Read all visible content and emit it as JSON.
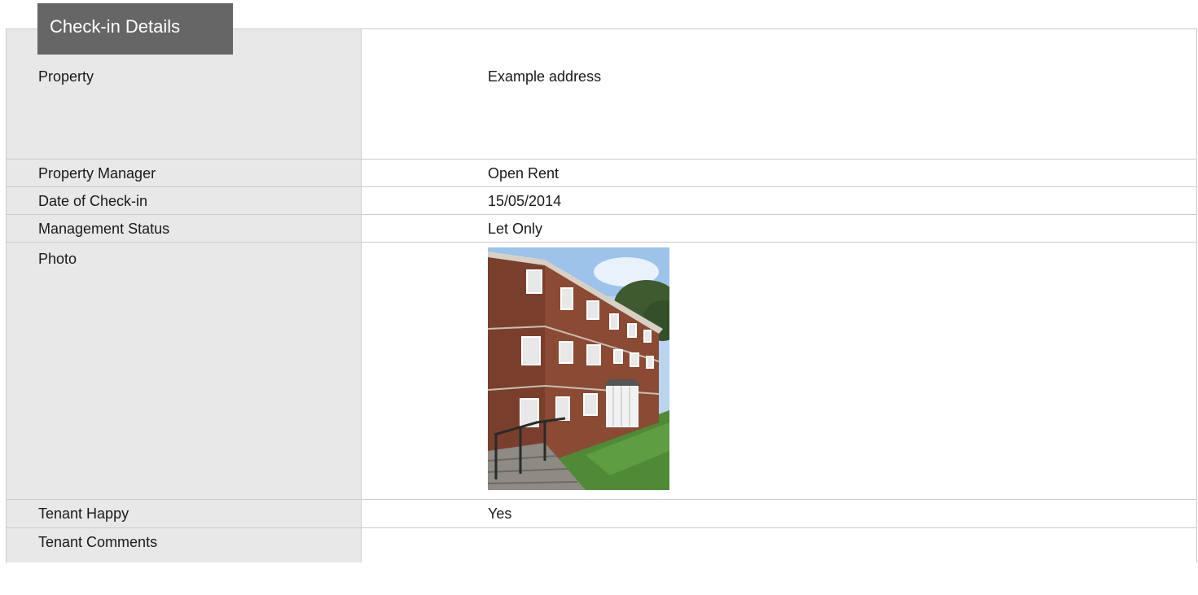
{
  "tab": {
    "title": "Check-in Details"
  },
  "rows": [
    {
      "label": "Property",
      "value": "Example address"
    },
    {
      "label": "Property Manager",
      "value": "Open Rent"
    },
    {
      "label": "Date of Check-in",
      "value": "15/05/2014"
    },
    {
      "label": "Management Status",
      "value": "Let Only"
    },
    {
      "label": "Photo",
      "value": ""
    },
    {
      "label": "Tenant Happy",
      "value": "Yes"
    },
    {
      "label": "Tenant Comments",
      "value": ""
    }
  ],
  "colors": {
    "tab_bg": "#666666",
    "label_bg": "#e8e8e8",
    "border": "#cccccc"
  }
}
